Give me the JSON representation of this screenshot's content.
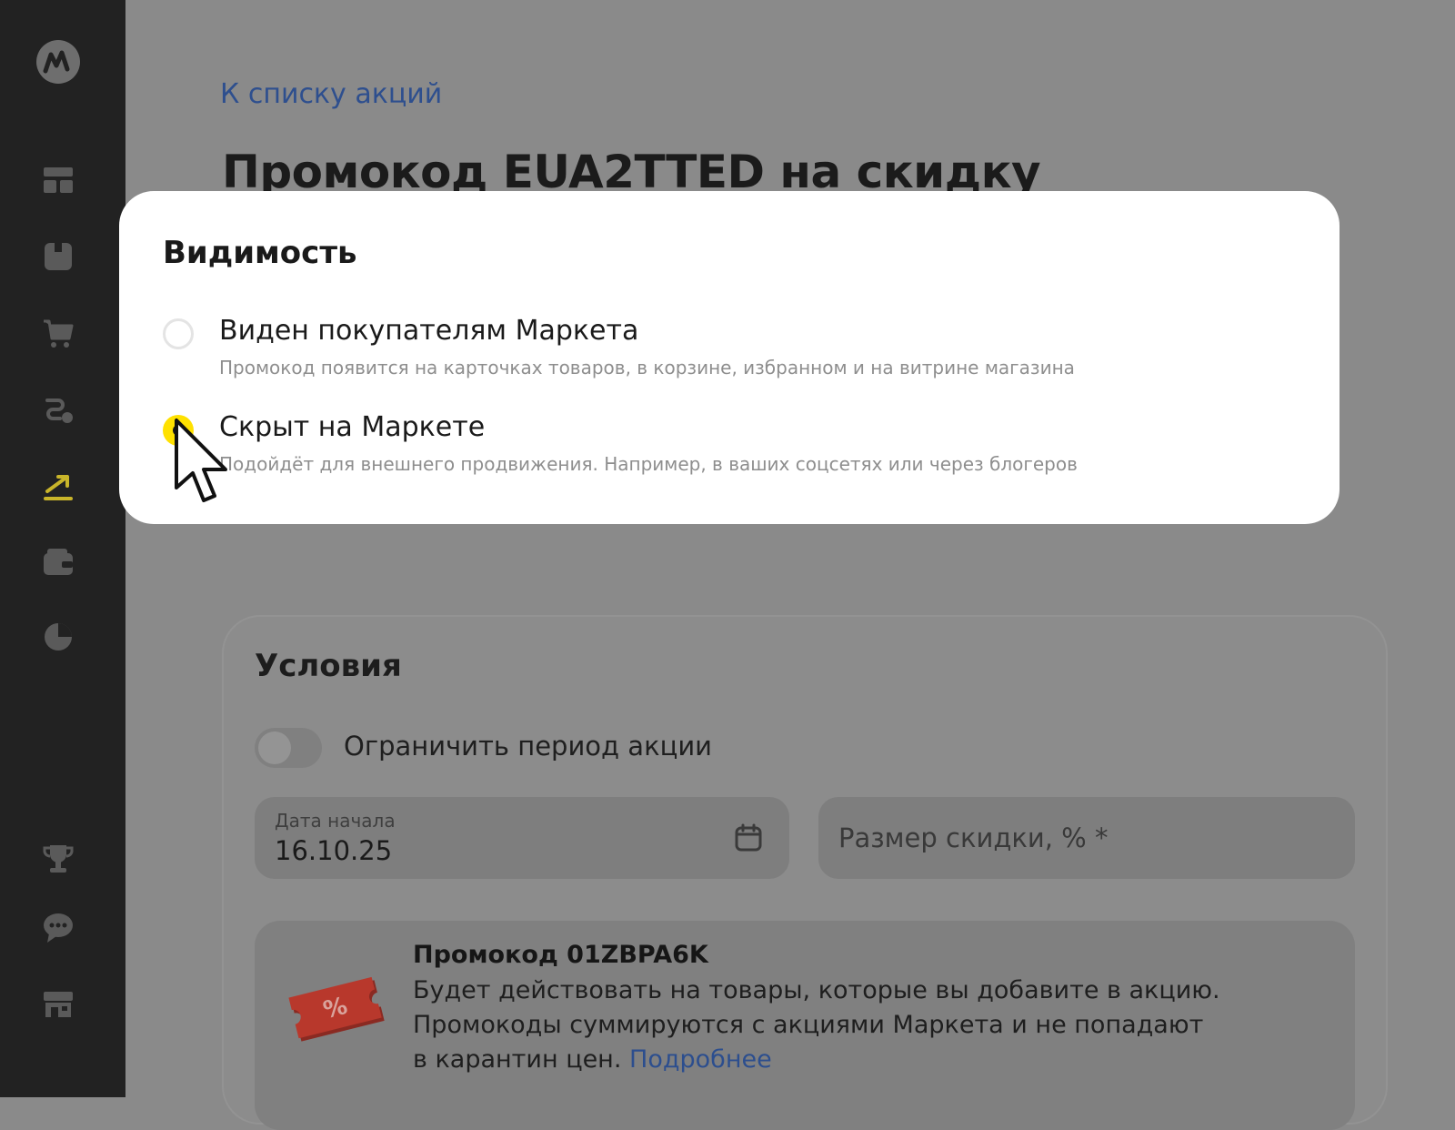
{
  "app": {
    "logo_icon": "market-logo-icon"
  },
  "sidebar": {
    "items": [
      {
        "icon": "dashboard-icon",
        "active": false
      },
      {
        "icon": "box-icon",
        "active": false
      },
      {
        "icon": "cart-icon",
        "active": false
      },
      {
        "icon": "route-icon",
        "active": false
      },
      {
        "icon": "promo-growth-icon",
        "active": true
      },
      {
        "icon": "wallet-icon",
        "active": false
      },
      {
        "icon": "pie-chart-icon",
        "active": false
      },
      {
        "icon": "trophy-icon",
        "active": false
      },
      {
        "icon": "chat-icon",
        "active": false
      },
      {
        "icon": "storefront-icon",
        "active": false
      }
    ],
    "colors": {
      "background": "#222222",
      "icon": "#5a5a5a",
      "active_icon": "#c9b52a"
    }
  },
  "page": {
    "back_link": "К списку акций",
    "title": "Промокод EUA2TTED на скидку"
  },
  "conditions": {
    "title": "Условия",
    "toggle_label": "Ограничить период акции",
    "toggle_on": false,
    "start_date": {
      "label": "Дата начала",
      "value": "16.10.25"
    },
    "discount": {
      "placeholder": "Размер скидки, % *"
    },
    "promo": {
      "title": "Промокод 01ZBPA6K",
      "text_line1": "Будет действовать на товары, которые вы добавите в акцию.",
      "text_line2": "Промокоды суммируются с акциями Маркета и не попадают",
      "text_line3": "в карантин цен.",
      "more_link": "Подробнее",
      "ticket_label": "%"
    }
  },
  "visibility_modal": {
    "title": "Видимость",
    "options": [
      {
        "label": "Виден покупателям Маркета",
        "description": "Промокод появится на карточках товаров, в корзине, избранном и на витрине магазина",
        "selected": false
      },
      {
        "label": "Скрыт на Маркете",
        "description": "Подойдёт для внешнего продвижения. Например, в ваших соцсетях или через блогеров",
        "selected": true
      }
    ],
    "accent_color": "#ffe100"
  }
}
